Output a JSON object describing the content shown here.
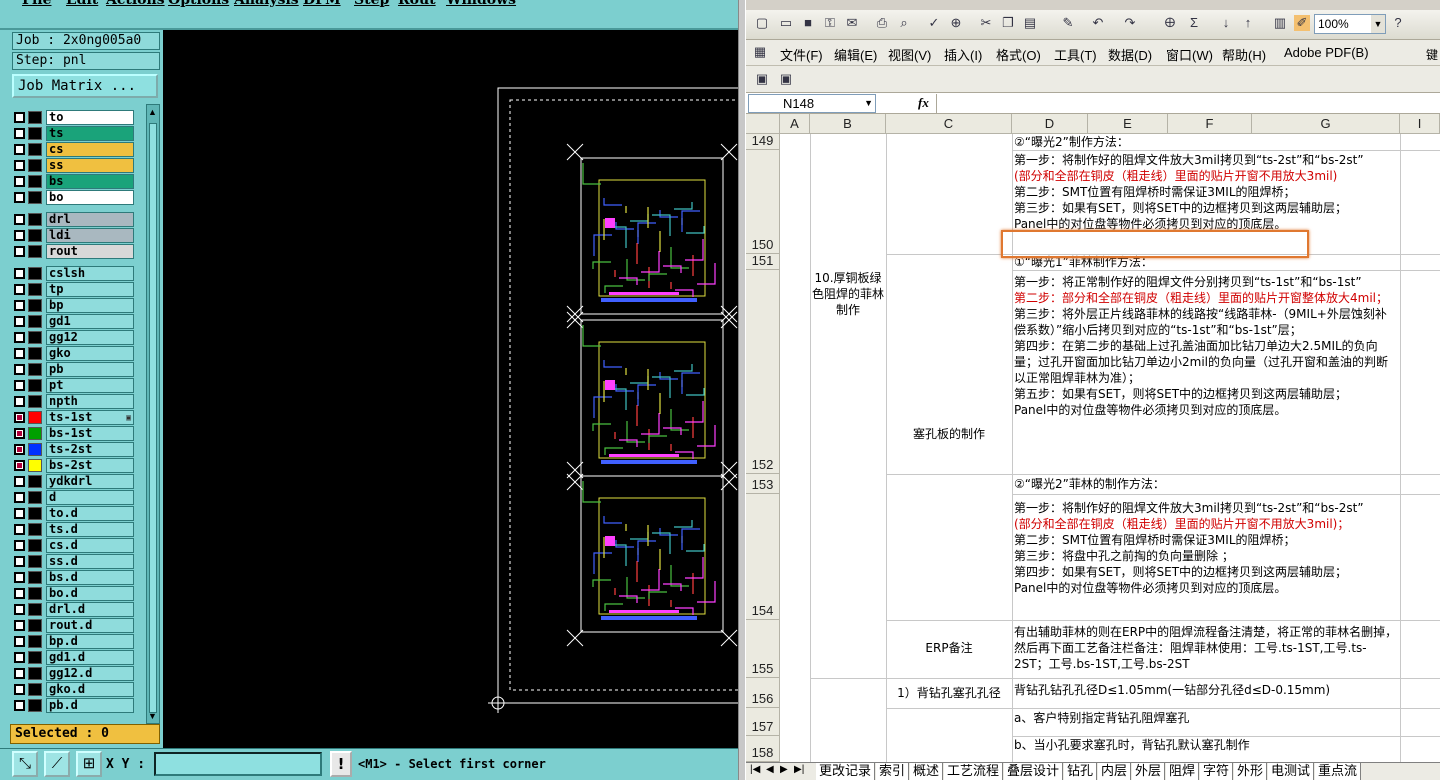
{
  "left_app": {
    "menu": [
      "File",
      "Edit",
      "Actions",
      "Options",
      "Analysis",
      "DFM",
      "Step",
      "Rout",
      "Windows"
    ],
    "job_label": "Job : 2x0ng005a0",
    "step_label": "Step: pnl",
    "job_matrix_label": "Job Matrix ...",
    "layers": [
      {
        "name": "to",
        "color": "#ffffff",
        "checked": false,
        "swatch": "#000000"
      },
      {
        "name": "ts",
        "color": "#1aa37a",
        "checked": false,
        "swatch": "#000000"
      },
      {
        "name": "cs",
        "color": "#f0c040",
        "checked": false,
        "swatch": "#000000"
      },
      {
        "name": "ss",
        "color": "#f0c040",
        "checked": false,
        "swatch": "#000000"
      },
      {
        "name": "bs",
        "color": "#1aa37a",
        "checked": false,
        "swatch": "#000000"
      },
      {
        "name": "bo",
        "color": "#ffffff",
        "checked": false,
        "swatch": "#000000"
      },
      {
        "name": "drl",
        "color": "#a9b8c0",
        "checked": false,
        "swatch": "#000000"
      },
      {
        "name": "ldi",
        "color": "#a9b8c0",
        "checked": false,
        "swatch": "#000000"
      },
      {
        "name": "rout",
        "color": "#d8d8d8",
        "checked": false,
        "swatch": "#000000"
      },
      {
        "name": "cslsh",
        "color": "#8fdcdc",
        "checked": false,
        "swatch": "#000000"
      },
      {
        "name": "tp",
        "color": "#8fdcdc",
        "checked": false,
        "swatch": "#000000"
      },
      {
        "name": "bp",
        "color": "#8fdcdc",
        "checked": false,
        "swatch": "#000000"
      },
      {
        "name": "gd1",
        "color": "#8fdcdc",
        "checked": false,
        "swatch": "#000000"
      },
      {
        "name": "gg12",
        "color": "#8fdcdc",
        "checked": false,
        "swatch": "#000000"
      },
      {
        "name": "gko",
        "color": "#8fdcdc",
        "checked": false,
        "swatch": "#000000"
      },
      {
        "name": "pb",
        "color": "#8fdcdc",
        "checked": false,
        "swatch": "#000000"
      },
      {
        "name": "pt",
        "color": "#8fdcdc",
        "checked": false,
        "swatch": "#000000"
      },
      {
        "name": "npth",
        "color": "#8fdcdc",
        "checked": false,
        "swatch": "#000000"
      },
      {
        "name": "ts-1st",
        "color": "#8fdcdc",
        "checked": true,
        "swatch": "#ff0000",
        "marker": true
      },
      {
        "name": "bs-1st",
        "color": "#8fdcdc",
        "checked": true,
        "swatch": "#00a000"
      },
      {
        "name": "ts-2st",
        "color": "#8fdcdc",
        "checked": true,
        "swatch": "#0030ff"
      },
      {
        "name": "bs-2st",
        "color": "#8fdcdc",
        "checked": true,
        "swatch": "#ffff00"
      },
      {
        "name": "ydkdrl",
        "color": "#8fdcdc",
        "checked": false,
        "swatch": "#000000"
      },
      {
        "name": "d",
        "color": "#8fdcdc",
        "checked": false,
        "swatch": "#000000"
      },
      {
        "name": "to.d",
        "color": "#8fdcdc",
        "checked": false,
        "swatch": "#000000"
      },
      {
        "name": "ts.d",
        "color": "#8fdcdc",
        "checked": false,
        "swatch": "#000000"
      },
      {
        "name": "cs.d",
        "color": "#8fdcdc",
        "checked": false,
        "swatch": "#000000"
      },
      {
        "name": "ss.d",
        "color": "#8fdcdc",
        "checked": false,
        "swatch": "#000000"
      },
      {
        "name": "bs.d",
        "color": "#8fdcdc",
        "checked": false,
        "swatch": "#000000"
      },
      {
        "name": "bo.d",
        "color": "#8fdcdc",
        "checked": false,
        "swatch": "#000000"
      },
      {
        "name": "drl.d",
        "color": "#8fdcdc",
        "checked": false,
        "swatch": "#000000"
      },
      {
        "name": "rout.d",
        "color": "#8fdcdc",
        "checked": false,
        "swatch": "#000000"
      },
      {
        "name": "bp.d",
        "color": "#8fdcdc",
        "checked": false,
        "swatch": "#000000"
      },
      {
        "name": "gd1.d",
        "color": "#8fdcdc",
        "checked": false,
        "swatch": "#000000"
      },
      {
        "name": "gg12.d",
        "color": "#8fdcdc",
        "checked": false,
        "swatch": "#000000"
      },
      {
        "name": "gko.d",
        "color": "#8fdcdc",
        "checked": false,
        "swatch": "#000000"
      },
      {
        "name": "pb.d",
        "color": "#8fdcdc",
        "checked": false,
        "swatch": "#000000"
      }
    ],
    "selected_label": "Selected : 0",
    "xy_label": "X Y :",
    "warn_icon": "!",
    "status_text": "<M1> - Select first corner"
  },
  "excel": {
    "zoom": "100%",
    "menu": [
      "文件(F)",
      "编辑(E)",
      "视图(V)",
      "插入(I)",
      "格式(O)",
      "工具(T)",
      "数据(D)",
      "窗口(W)",
      "帮助(H)",
      "Adobe PDF(B)"
    ],
    "menu_side": "键",
    "name_box": "N148",
    "fx_label": "fx",
    "columns": [
      "A",
      "B",
      "C",
      "D",
      "E",
      "F",
      "G",
      "I"
    ],
    "row_numbers": [
      "149",
      "150",
      "151",
      "152",
      "153",
      "154",
      "155",
      "156",
      "157",
      "158"
    ],
    "b_merged": "10.厚铜板绿色阻焊的菲林制作",
    "c_plug": "塞孔板的制作",
    "c_erp": "ERP备注",
    "c_backdrill": "1）背钻孔塞孔孔径",
    "r149": "②“曝光2”制作方法：",
    "r150": [
      {
        "t": "第一步：将制作好的阻焊文件放大3mil拷贝到“ts-2st”和“bs-2st”",
        "red": false
      },
      {
        "t": "(部分和全部在铜皮（粗走线）里面的贴片开窗不用放大3mil)",
        "red": true
      },
      {
        "t": "第二步：SMT位置有阻焊桥时需保证3MIL的阻焊桥；",
        "red": false
      },
      {
        "t": "第三步：如果有SET，则将SET中的边框拷贝到这两层辅助层；",
        "red": false
      },
      {
        "t": "Panel中的对位盘等物件必须拷贝到对应的顶底层。",
        "red": false
      }
    ],
    "r151": "①“曝光1”菲林制作方法：",
    "r152": [
      {
        "t": "第一步：将正常制作好的阻焊文件分别拷贝到“ts-1st”和“bs-1st”",
        "red": false
      },
      {
        "t": "第二步：部分和全部在铜皮（粗走线）里面的贴片开窗整体放大4mil；",
        "red": true
      },
      {
        "t": "第三步：将外层正片线路菲林的线路按“线路菲林-（9MIL+外层蚀刻补偿系数）”缩小后拷贝到对应的“ts-1st”和“bs-1st”层；",
        "red": false
      },
      {
        "t": "第四步：在第二步的基础上过孔盖油面加比钻刀单边大2.5MIL的负向量；过孔开窗面加比钻刀单边小2mil的负向量（过孔开窗和盖油的判断以正常阻焊菲林为准）；",
        "red": false
      },
      {
        "t": "第五步：如果有SET，则将SET中的边框拷贝到这两层辅助层；",
        "red": false
      },
      {
        "t": "Panel中的对位盘等物件必须拷贝到对应的顶底层。",
        "red": false
      }
    ],
    "r153": "②“曝光2”菲林的制作方法：",
    "r154": [
      {
        "t": "第一步：将制作好的阻焊文件放大3mil拷贝到“ts-2st”和“bs-2st”",
        "red": false
      },
      {
        "t": "(部分和全部在铜皮（粗走线）里面的贴片开窗不用放大3mil)；",
        "red": true
      },
      {
        "t": "第二步：SMT位置有阻焊桥时需保证3MIL的阻焊桥；",
        "red": false
      },
      {
        "t": "第三步：将盘中孔之前掏的负向量删除 ；",
        "red": false
      },
      {
        "t": "第四步：如果有SET，则将SET中的边框拷贝到这两层辅助层；",
        "red": false
      },
      {
        "t": "Panel中的对位盘等物件必须拷贝到对应的顶底层。",
        "red": false
      }
    ],
    "r155": "有出辅助菲林的则在ERP中的阻焊流程备注清楚，将正常的菲林名删掉，然后再下面工艺备注栏备注：阻焊菲林使用：工号.ts-1ST,工号.ts-2ST；工号.bs-1ST,工号.bs-2ST",
    "r156": "背钻孔钻孔孔径D≤1.05mm(一钻部分孔径d≤D-0.15mm)",
    "r157": "a、客户特别指定背钻孔阻焊塞孔",
    "r158": "b、当小孔要求塞孔时，背钻孔默认塞孔制作",
    "sheet_tabs": [
      "更改记录",
      "索引",
      "概述",
      "工艺流程",
      "叠层设计",
      "钻孔",
      "内层",
      "外层",
      "阻焊",
      "字符",
      "外形",
      "电测试",
      "重点流"
    ]
  }
}
